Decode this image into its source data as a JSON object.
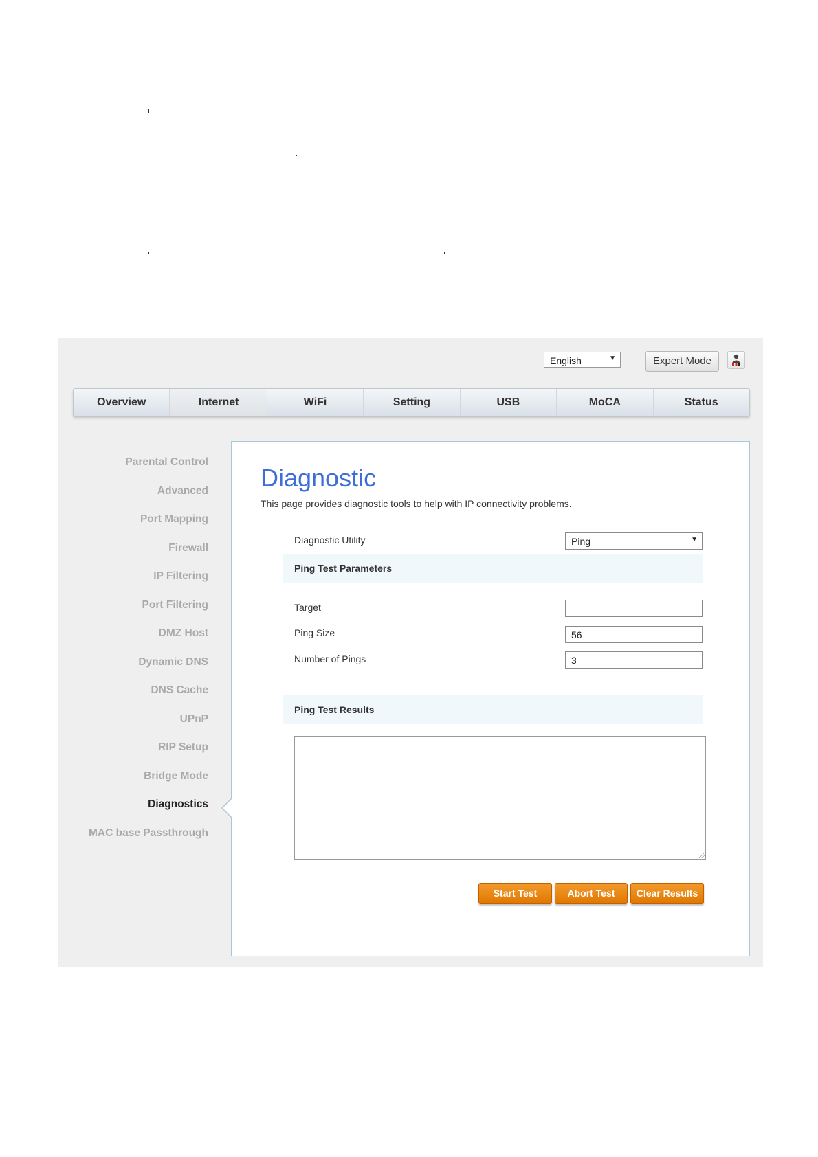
{
  "topbar": {
    "language": "English",
    "expert_mode": "Expert Mode",
    "user_icon": "user-icon"
  },
  "nav": {
    "tabs": [
      {
        "label": "Overview",
        "active": false
      },
      {
        "label": "Internet",
        "active": true
      },
      {
        "label": "WiFi",
        "active": false
      },
      {
        "label": "Setting",
        "active": false
      },
      {
        "label": "USB",
        "active": false
      },
      {
        "label": "MoCA",
        "active": false
      },
      {
        "label": "Status",
        "active": false
      }
    ]
  },
  "sidebar": {
    "items": [
      {
        "label": "Parental Control"
      },
      {
        "label": "Advanced"
      },
      {
        "label": "Port Mapping"
      },
      {
        "label": "Firewall"
      },
      {
        "label": "IP Filtering"
      },
      {
        "label": "Port Filtering"
      },
      {
        "label": "DMZ Host"
      },
      {
        "label": "Dynamic DNS"
      },
      {
        "label": "DNS Cache"
      },
      {
        "label": "UPnP"
      },
      {
        "label": "RIP Setup"
      },
      {
        "label": "Bridge Mode"
      },
      {
        "label": "Diagnostics",
        "active": true
      },
      {
        "label": "MAC base Passthrough"
      }
    ]
  },
  "main": {
    "title": "Diagnostic",
    "description": "This page provides diagnostic tools to help with IP connectivity problems.",
    "utility_label": "Diagnostic Utility",
    "utility_value": "Ping",
    "params_header": "Ping Test Parameters",
    "target_label": "Target",
    "target_value": "",
    "ping_size_label": "Ping Size",
    "ping_size_value": "56",
    "num_pings_label": "Number of Pings",
    "num_pings_value": "3",
    "results_header": "Ping Test Results",
    "results_value": "",
    "buttons": {
      "start": "Start Test",
      "abort": "Abort Test",
      "clear": "Clear Results"
    }
  },
  "colors": {
    "accent_title": "#3f6fd6",
    "button_orange": "#e98600",
    "panel_border": "#a7c8d8"
  }
}
